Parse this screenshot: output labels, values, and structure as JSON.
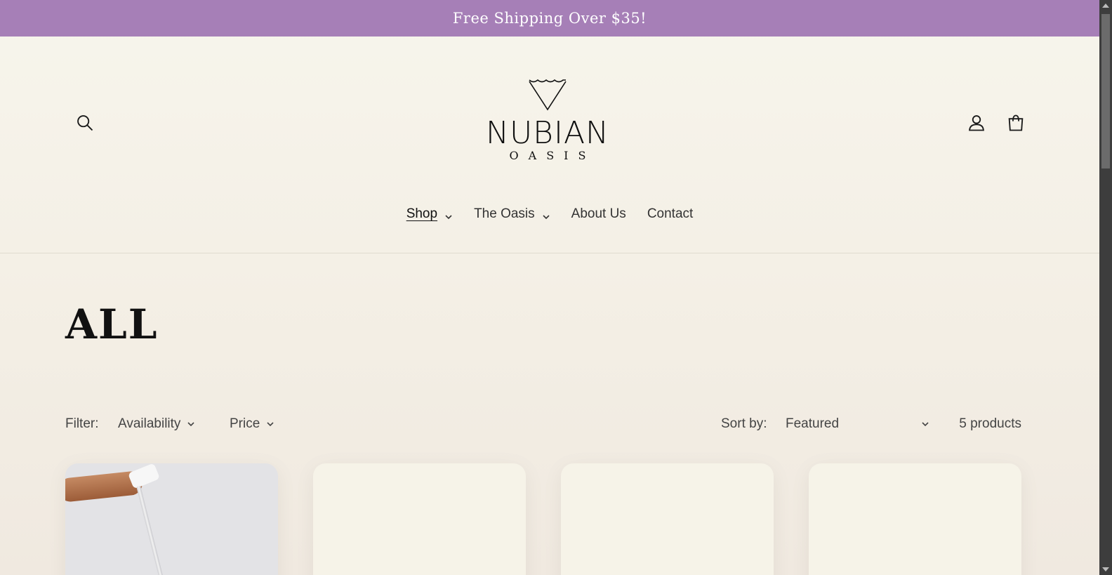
{
  "announcement": {
    "text": "Free Shipping Over $35!"
  },
  "header": {
    "logo": {
      "name": "NUBIAN",
      "tagline": "OASIS"
    },
    "icons": {
      "search": "search-icon",
      "account": "user-icon",
      "cart": "cart-icon"
    }
  },
  "nav": {
    "items": [
      {
        "label": "Shop",
        "active": true,
        "dropdown": true
      },
      {
        "label": "The Oasis",
        "active": false,
        "dropdown": true
      },
      {
        "label": "About Us",
        "active": false,
        "dropdown": false
      },
      {
        "label": "Contact",
        "active": false,
        "dropdown": false
      }
    ]
  },
  "collection": {
    "title": "ALL",
    "filter_label": "Filter:",
    "filters": [
      {
        "label": "Availability"
      },
      {
        "label": "Price"
      }
    ],
    "sort_label": "Sort by:",
    "sort_value": "Featured",
    "count": "5 products"
  },
  "colors": {
    "announcement_bg": "#a67fb7",
    "page_bg": "#f4efe6",
    "text": "#1a1a1a"
  }
}
